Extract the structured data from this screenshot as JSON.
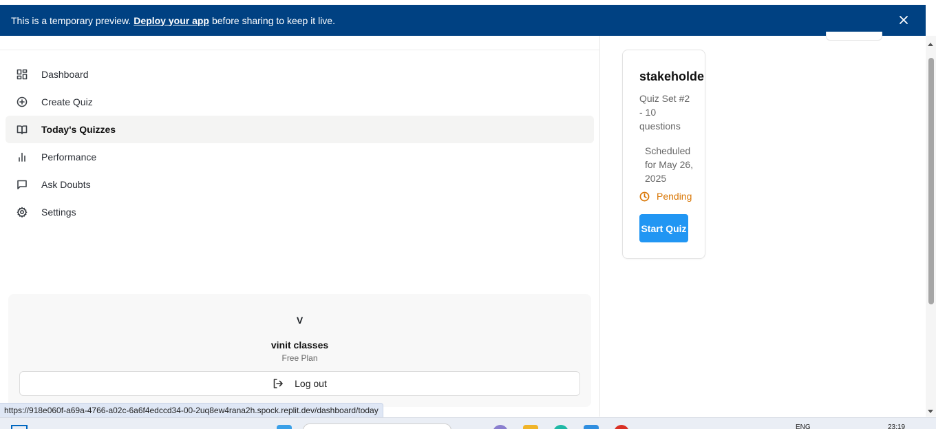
{
  "banner": {
    "text_before": "This is a temporary preview.",
    "link_text": "Deploy your app",
    "text_after": "before sharing to keep it live."
  },
  "sidebar": {
    "items": [
      {
        "label": "Dashboard",
        "icon": "dashboard-icon"
      },
      {
        "label": "Create Quiz",
        "icon": "plus-circle-icon"
      },
      {
        "label": "Today's Quizzes",
        "icon": "book-open-icon",
        "active": true
      },
      {
        "label": "Performance",
        "icon": "bar-chart-icon"
      },
      {
        "label": "Ask Doubts",
        "icon": "message-square-icon"
      },
      {
        "label": "Settings",
        "icon": "gear-icon"
      }
    ]
  },
  "user": {
    "avatar_initial": "V",
    "name": "vinit classes",
    "plan": "Free Plan",
    "logout_label": "Log out"
  },
  "quiz": {
    "title": "stakeholder",
    "subtitle": "Quiz Set #2 - 10 questions",
    "schedule": "Scheduled for May 26, 2025",
    "status": "Pending",
    "start_label": "Start Quiz"
  },
  "status_url": "https://918e060f-a69a-4766-a02c-6a6f4edccd34-00-2uq8ew4rana2h.spock.replit.dev/dashboard/today",
  "taskbar": {
    "lang": "ENG",
    "time": "23:19"
  },
  "colors": {
    "banner_bg": "#004182",
    "primary_button": "#2196f3",
    "pending": "#d97706",
    "active_nav_bg": "#f4f4f3"
  }
}
